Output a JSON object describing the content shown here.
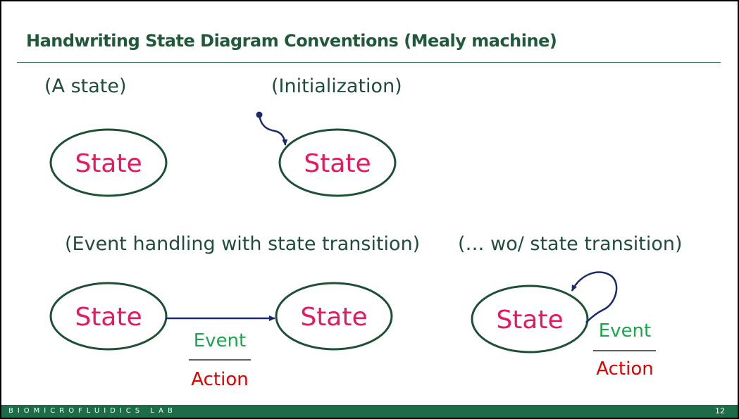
{
  "slide": {
    "title": "Handwriting State Diagram Conventions (Mealy machine)",
    "page_number": "12",
    "footer_lab": "BIOMICROFLUIDICS LAB"
  },
  "captions": {
    "a_state": "(A state)",
    "initialization": "(Initialization)",
    "with_transition": "(Event handling with state transition)",
    "without_transition": "(… wo/ state transition)"
  },
  "diagram": {
    "state_label": "State",
    "event_label": "Event",
    "action_label": "Action"
  },
  "colors": {
    "title": "#1e5a3a",
    "state_text": "#e6195f",
    "ellipse_stroke": "#1e5036",
    "arrow": "#1a2a6c",
    "event": "#1aa64a",
    "action": "#e00000",
    "footer_bg": "#1e6b4a"
  }
}
